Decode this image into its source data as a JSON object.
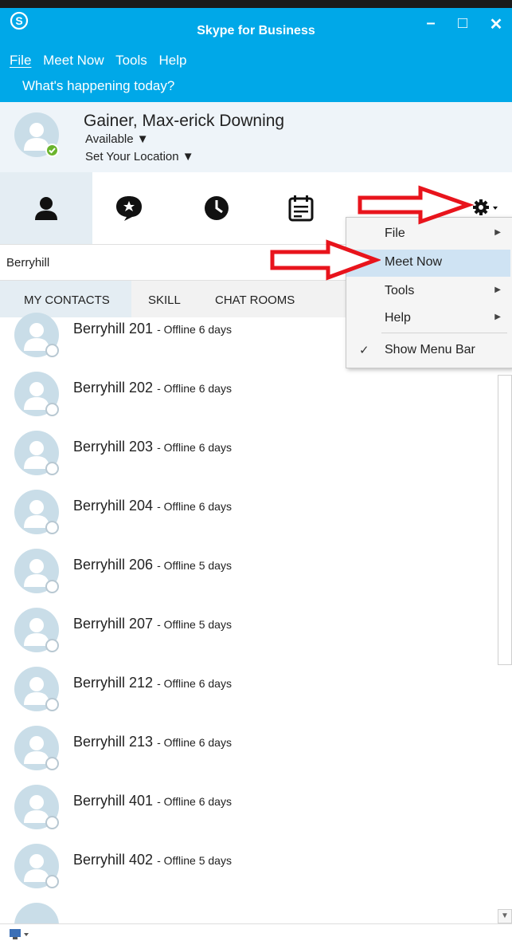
{
  "window": {
    "title": "Skype for Business",
    "minimize": "–",
    "maximize": "□",
    "close": "✕"
  },
  "menu": {
    "file": "File",
    "meet_now": "Meet Now",
    "tools": "Tools",
    "help": "Help"
  },
  "note_prompt": "What's happening today?",
  "profile": {
    "name": "Gainer, Max-erick Downing",
    "availability": "Available ▼",
    "location": "Set Your Location ▼"
  },
  "search": {
    "value": "Berryhill"
  },
  "subtabs": {
    "my_contacts": "MY CONTACTS",
    "skill": "SKILL",
    "chat_rooms": "CHAT ROOMS"
  },
  "contacts": [
    {
      "name": "Berryhill 201",
      "status": "- Offline 6 days"
    },
    {
      "name": "Berryhill 202",
      "status": "- Offline 6 days"
    },
    {
      "name": "Berryhill 203",
      "status": "- Offline 6 days"
    },
    {
      "name": "Berryhill 204",
      "status": "- Offline 6 days"
    },
    {
      "name": "Berryhill 206",
      "status": "- Offline 5 days"
    },
    {
      "name": "Berryhill 207",
      "status": "- Offline 5 days"
    },
    {
      "name": "Berryhill 212",
      "status": "- Offline 6 days"
    },
    {
      "name": "Berryhill 213",
      "status": "- Offline 6 days"
    },
    {
      "name": "Berryhill 401",
      "status": "- Offline 6 days"
    },
    {
      "name": "Berryhill 402",
      "status": "- Offline 5 days"
    }
  ],
  "dropdown": {
    "file": "File",
    "meet_now": "Meet Now",
    "tools": "Tools",
    "help": "Help",
    "show_menu_bar": "Show Menu Bar",
    "check": "✓"
  },
  "colors": {
    "brand_blue": "#00a8e8",
    "available_green": "#6ab42d",
    "annotation_red": "#e8141c"
  },
  "icons": [
    "skype-logo-icon",
    "contacts-icon",
    "chat-icon",
    "history-icon",
    "meetings-icon",
    "gear-icon",
    "present-icon"
  ]
}
